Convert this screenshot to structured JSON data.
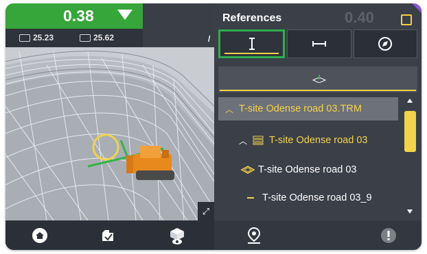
{
  "grade": {
    "value": "0.38"
  },
  "info": {
    "left_value": "25.23",
    "right_value": "25.62"
  },
  "panel": {
    "title": "References",
    "ghost_value": "0.40",
    "tabs": [
      {
        "name": "vertical-reference",
        "icon": "vertical-guide-icon",
        "active": true
      },
      {
        "name": "horizontal-reference",
        "icon": "horizontal-guide-icon",
        "active": false
      },
      {
        "name": "direction-reference",
        "icon": "compass-icon",
        "active": false
      }
    ],
    "layer_icon": "layers-icon",
    "tree": [
      {
        "label": "T-site Odense road 03.TRM",
        "icon": "chevron-up-icon",
        "indent": 0,
        "selected": true
      },
      {
        "label": "T-site Odense road 03",
        "icon": "layer-stack-icon",
        "indent": 1,
        "selected": false
      },
      {
        "label": "T-site Odense road 03",
        "icon": "surface-icon",
        "indent": 2,
        "selected": false
      },
      {
        "label": "T-site Odense road 03_9",
        "icon": "line-icon",
        "indent": 2,
        "selected": false
      }
    ]
  },
  "bottom_left": [
    "home-icon",
    "project-icon",
    "machine-view-icon"
  ],
  "bottom_right": [
    "location-pin-icon",
    "alert-icon"
  ],
  "colors": {
    "accent_green": "#36a53a",
    "accent_yellow": "#f2d349",
    "panel_bg": "#3b3f48"
  }
}
